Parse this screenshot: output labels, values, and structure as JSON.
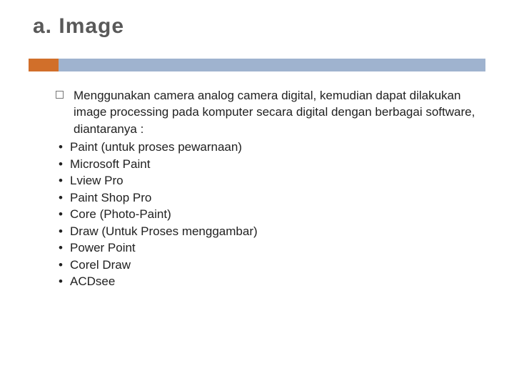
{
  "title": "a. Image",
  "intro": "Menggunakan camera analog  camera digital, kemudian dapat dilakukan image processing pada komputer secara digital dengan berbagai software, diantaranya :",
  "items": [
    "Paint (untuk proses pewarnaan)",
    "Microsoft Paint",
    "Lview Pro",
    "Paint Shop Pro",
    "Core (Photo-Paint)",
    "Draw (Untuk Proses menggambar)",
    "Power Point",
    "Corel Draw",
    "ACDsee"
  ],
  "colors": {
    "accent": "#d16f2a",
    "bar": "#9fb3cf"
  }
}
